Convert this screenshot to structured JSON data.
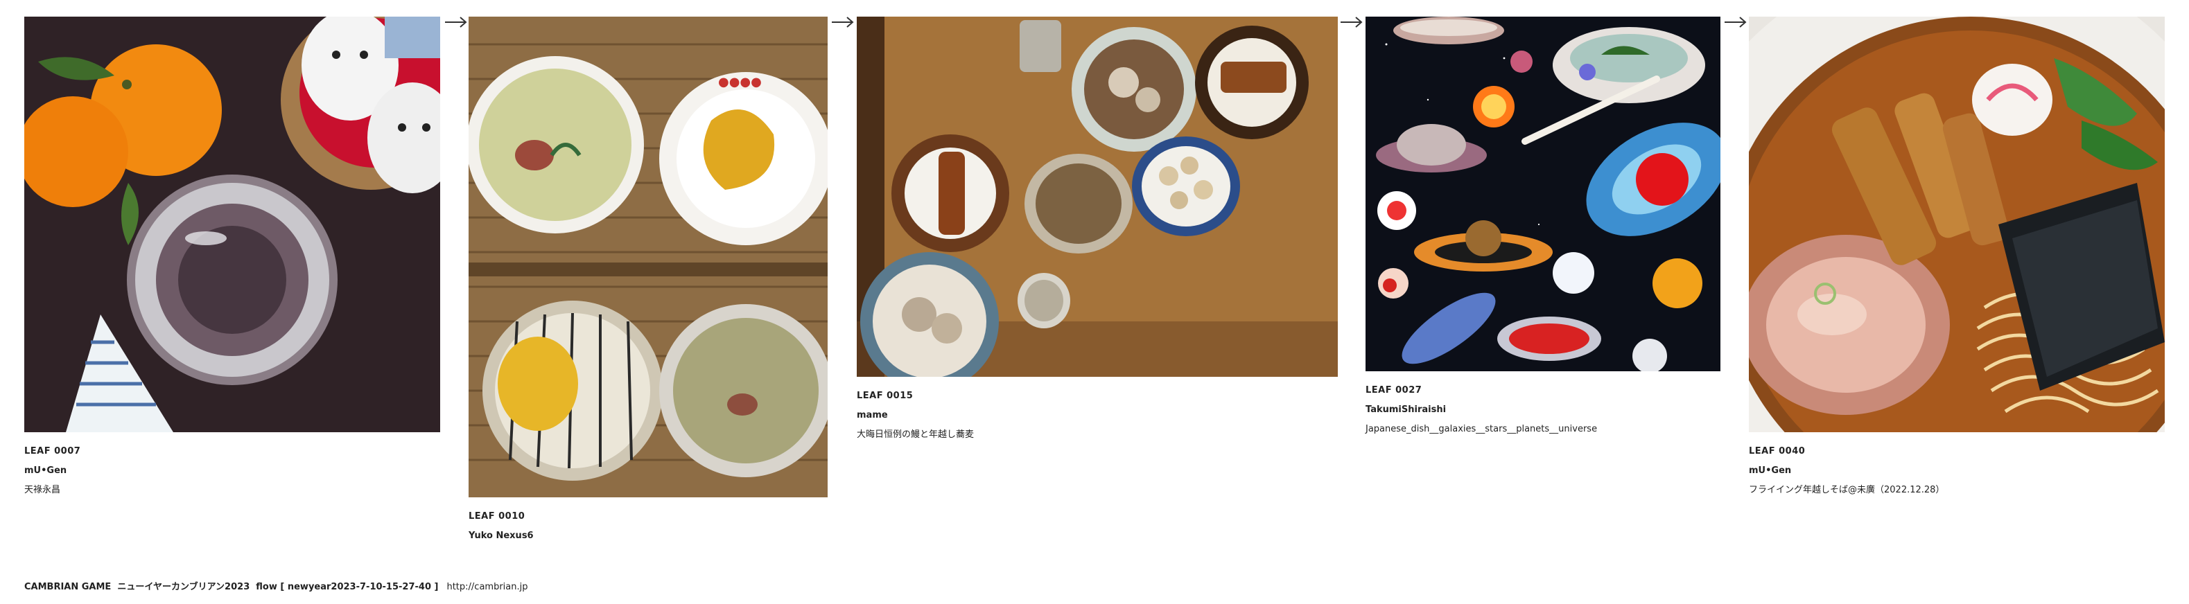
{
  "leaves": [
    {
      "id": "LEAF 0007",
      "author": "mU•Gen",
      "title": "天祿永昌",
      "image": "oranges-sake-cup-photo"
    },
    {
      "id": "LEAF 0010",
      "author": "Yuko Nexus6",
      "title": "",
      "image": "tea-and-sweets-photo"
    },
    {
      "id": "LEAF 0015",
      "author": "mame",
      "title": "大晦日恒例の鰻と年越し蕎麦",
      "image": "eel-and-soba-dinner-photo"
    },
    {
      "id": "LEAF 0027",
      "author": "TakumiShiraishi",
      "title": "Japanese_dish__galaxies__stars__planets__universe",
      "image": "space-dishes-illustration"
    },
    {
      "id": "LEAF 0040",
      "author": "mU•Gen",
      "title": "フライイング年越しそば@未廣（2022.12.28）",
      "image": "ramen-bowl-photo"
    }
  ],
  "footer": {
    "text": "CAMBRIAN GAME  ニューイヤーカンブリアン2023  flow [ newyear2023-7-10-15-27-40 ]",
    "url": "http://cambrian.jp"
  },
  "colors": {
    "text": "#222222",
    "background": "#ffffff"
  }
}
